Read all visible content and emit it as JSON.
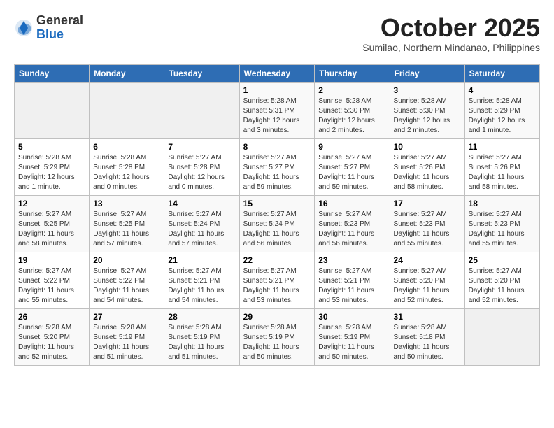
{
  "logo": {
    "general": "General",
    "blue": "Blue"
  },
  "title": "October 2025",
  "subtitle": "Sumilao, Northern Mindanao, Philippines",
  "days_of_week": [
    "Sunday",
    "Monday",
    "Tuesday",
    "Wednesday",
    "Thursday",
    "Friday",
    "Saturday"
  ],
  "weeks": [
    [
      {
        "day": "",
        "info": ""
      },
      {
        "day": "",
        "info": ""
      },
      {
        "day": "",
        "info": ""
      },
      {
        "day": "1",
        "info": "Sunrise: 5:28 AM\nSunset: 5:31 PM\nDaylight: 12 hours\nand 3 minutes."
      },
      {
        "day": "2",
        "info": "Sunrise: 5:28 AM\nSunset: 5:30 PM\nDaylight: 12 hours\nand 2 minutes."
      },
      {
        "day": "3",
        "info": "Sunrise: 5:28 AM\nSunset: 5:30 PM\nDaylight: 12 hours\nand 2 minutes."
      },
      {
        "day": "4",
        "info": "Sunrise: 5:28 AM\nSunset: 5:29 PM\nDaylight: 12 hours\nand 1 minute."
      }
    ],
    [
      {
        "day": "5",
        "info": "Sunrise: 5:28 AM\nSunset: 5:29 PM\nDaylight: 12 hours\nand 1 minute."
      },
      {
        "day": "6",
        "info": "Sunrise: 5:28 AM\nSunset: 5:28 PM\nDaylight: 12 hours\nand 0 minutes."
      },
      {
        "day": "7",
        "info": "Sunrise: 5:27 AM\nSunset: 5:28 PM\nDaylight: 12 hours\nand 0 minutes."
      },
      {
        "day": "8",
        "info": "Sunrise: 5:27 AM\nSunset: 5:27 PM\nDaylight: 11 hours\nand 59 minutes."
      },
      {
        "day": "9",
        "info": "Sunrise: 5:27 AM\nSunset: 5:27 PM\nDaylight: 11 hours\nand 59 minutes."
      },
      {
        "day": "10",
        "info": "Sunrise: 5:27 AM\nSunset: 5:26 PM\nDaylight: 11 hours\nand 58 minutes."
      },
      {
        "day": "11",
        "info": "Sunrise: 5:27 AM\nSunset: 5:26 PM\nDaylight: 11 hours\nand 58 minutes."
      }
    ],
    [
      {
        "day": "12",
        "info": "Sunrise: 5:27 AM\nSunset: 5:25 PM\nDaylight: 11 hours\nand 58 minutes."
      },
      {
        "day": "13",
        "info": "Sunrise: 5:27 AM\nSunset: 5:25 PM\nDaylight: 11 hours\nand 57 minutes."
      },
      {
        "day": "14",
        "info": "Sunrise: 5:27 AM\nSunset: 5:24 PM\nDaylight: 11 hours\nand 57 minutes."
      },
      {
        "day": "15",
        "info": "Sunrise: 5:27 AM\nSunset: 5:24 PM\nDaylight: 11 hours\nand 56 minutes."
      },
      {
        "day": "16",
        "info": "Sunrise: 5:27 AM\nSunset: 5:23 PM\nDaylight: 11 hours\nand 56 minutes."
      },
      {
        "day": "17",
        "info": "Sunrise: 5:27 AM\nSunset: 5:23 PM\nDaylight: 11 hours\nand 55 minutes."
      },
      {
        "day": "18",
        "info": "Sunrise: 5:27 AM\nSunset: 5:23 PM\nDaylight: 11 hours\nand 55 minutes."
      }
    ],
    [
      {
        "day": "19",
        "info": "Sunrise: 5:27 AM\nSunset: 5:22 PM\nDaylight: 11 hours\nand 55 minutes."
      },
      {
        "day": "20",
        "info": "Sunrise: 5:27 AM\nSunset: 5:22 PM\nDaylight: 11 hours\nand 54 minutes."
      },
      {
        "day": "21",
        "info": "Sunrise: 5:27 AM\nSunset: 5:21 PM\nDaylight: 11 hours\nand 54 minutes."
      },
      {
        "day": "22",
        "info": "Sunrise: 5:27 AM\nSunset: 5:21 PM\nDaylight: 11 hours\nand 53 minutes."
      },
      {
        "day": "23",
        "info": "Sunrise: 5:27 AM\nSunset: 5:21 PM\nDaylight: 11 hours\nand 53 minutes."
      },
      {
        "day": "24",
        "info": "Sunrise: 5:27 AM\nSunset: 5:20 PM\nDaylight: 11 hours\nand 52 minutes."
      },
      {
        "day": "25",
        "info": "Sunrise: 5:27 AM\nSunset: 5:20 PM\nDaylight: 11 hours\nand 52 minutes."
      }
    ],
    [
      {
        "day": "26",
        "info": "Sunrise: 5:28 AM\nSunset: 5:20 PM\nDaylight: 11 hours\nand 52 minutes."
      },
      {
        "day": "27",
        "info": "Sunrise: 5:28 AM\nSunset: 5:19 PM\nDaylight: 11 hours\nand 51 minutes."
      },
      {
        "day": "28",
        "info": "Sunrise: 5:28 AM\nSunset: 5:19 PM\nDaylight: 11 hours\nand 51 minutes."
      },
      {
        "day": "29",
        "info": "Sunrise: 5:28 AM\nSunset: 5:19 PM\nDaylight: 11 hours\nand 50 minutes."
      },
      {
        "day": "30",
        "info": "Sunrise: 5:28 AM\nSunset: 5:19 PM\nDaylight: 11 hours\nand 50 minutes."
      },
      {
        "day": "31",
        "info": "Sunrise: 5:28 AM\nSunset: 5:18 PM\nDaylight: 11 hours\nand 50 minutes."
      },
      {
        "day": "",
        "info": ""
      }
    ]
  ]
}
